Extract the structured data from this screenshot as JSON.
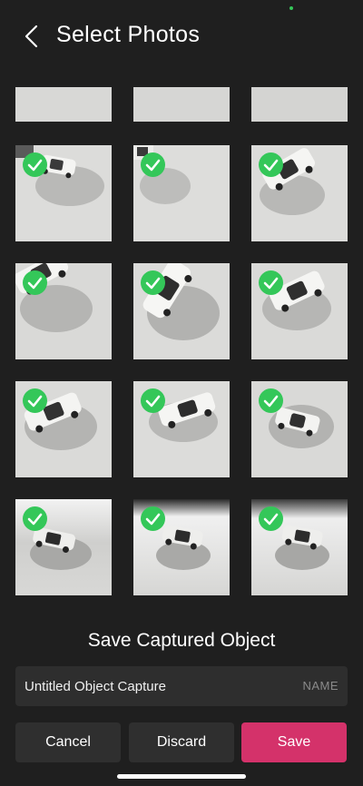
{
  "header": {
    "title": "Select Photos",
    "back_icon": "chevron-left-icon"
  },
  "photos": {
    "partial_row_count": 3,
    "rows": [
      [
        {
          "selected": true
        },
        {
          "selected": true
        },
        {
          "selected": true
        }
      ],
      [
        {
          "selected": true
        },
        {
          "selected": true
        },
        {
          "selected": true
        }
      ],
      [
        {
          "selected": true
        },
        {
          "selected": true
        },
        {
          "selected": true
        }
      ],
      [
        {
          "selected": true
        },
        {
          "selected": true
        },
        {
          "selected": true
        }
      ]
    ]
  },
  "save_section": {
    "title": "Save Captured Object",
    "name_value": "Untitled Object Capture",
    "name_label": "NAME"
  },
  "actions": {
    "cancel_label": "Cancel",
    "discard_label": "Discard",
    "save_label": "Save"
  },
  "colors": {
    "background": "#1f1f1f",
    "accent": "#d4326a",
    "check": "#34c759",
    "button": "#2f2f2f"
  }
}
